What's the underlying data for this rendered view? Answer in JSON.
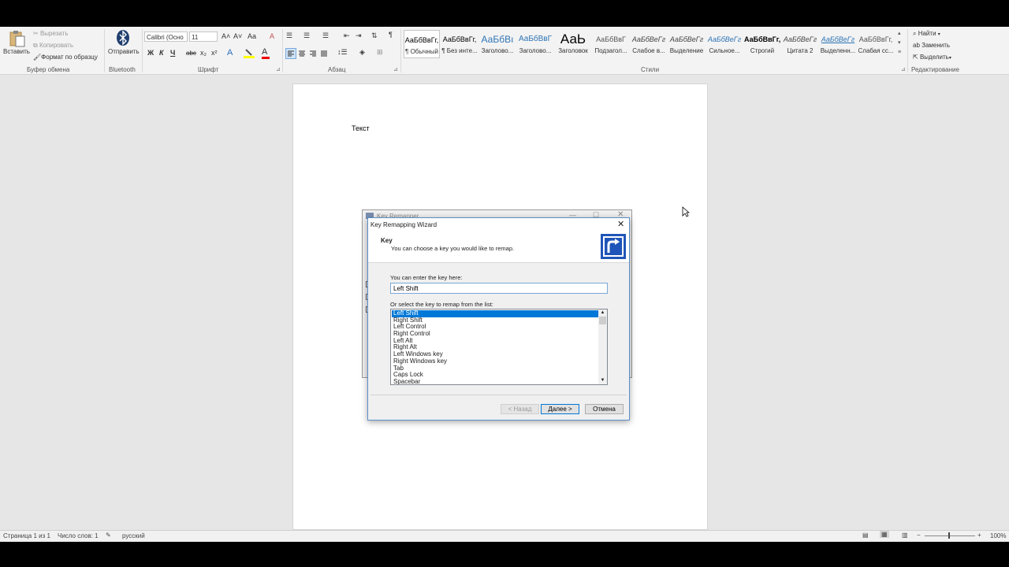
{
  "ribbon": {
    "clipboard": {
      "paste": "Вставить",
      "cut": "Вырезать",
      "copy": "Копировать",
      "format_painter": "Формат по образцу",
      "group": "Буфер обмена"
    },
    "bluetooth": {
      "send": "Отправить",
      "group": "Bluetooth"
    },
    "font": {
      "name": "Calibri (Осно",
      "size": "11",
      "group": "Шрифт",
      "bold": "Ж",
      "italic": "К",
      "underline": "Ч",
      "strike": "abc",
      "sub": "x₂",
      "sup": "x²",
      "grow": "A˄",
      "shrink": "A˅",
      "case": "Aa",
      "clear": "A"
    },
    "paragraph": {
      "group": "Абзац",
      "marks": "¶"
    },
    "styles": {
      "group": "Стили",
      "items": [
        {
          "preview": "АаБбВвГг,",
          "name": "¶ Обычный"
        },
        {
          "preview": "АаБбВвГг,",
          "name": "¶ Без инте..."
        },
        {
          "preview": "АаБбВı",
          "name": "Заголово..."
        },
        {
          "preview": "АаБбВвГ",
          "name": "Заголово..."
        },
        {
          "preview": "АаЬ",
          "name": "Заголовок"
        },
        {
          "preview": "АаБбВвГ",
          "name": "Подзагол..."
        },
        {
          "preview": "АаБбВеГг",
          "name": "Слабое в..."
        },
        {
          "preview": "АаБбВеГг",
          "name": "Выделение"
        },
        {
          "preview": "АаБбВеГг",
          "name": "Сильное..."
        },
        {
          "preview": "АаБбВвГг,",
          "name": "Строгий"
        },
        {
          "preview": "АаБбВеГг",
          "name": "Цитата 2"
        },
        {
          "preview": "АаБбВеГг",
          "name": "Выделенн..."
        },
        {
          "preview": "АаБбВвГг,",
          "name": "Слабая сс..."
        }
      ]
    },
    "editing": {
      "find": "Найти",
      "replace": "Заменить",
      "select": "Выделить",
      "group": "Редактирование"
    }
  },
  "document": {
    "text": "Текст"
  },
  "status": {
    "page": "Страница 1 из 1",
    "words": "Число слов: 1",
    "lang": "русский",
    "zoom": "100%"
  },
  "bg_window": {
    "title": "Key Remapper"
  },
  "wizard": {
    "title": "Key Remapping Wizard",
    "heading": "Key",
    "subheading": "You can choose a key you would like to remap.",
    "enter_label": "You can enter the key here:",
    "key_value": "Left Shift",
    "list_label": "Or select the key to remap from the list:",
    "keys": [
      "Left Shift",
      "Right Shift",
      "Left Control",
      "Right Control",
      "Left Alt",
      "Right Alt",
      "Left Windows key",
      "Right Windows key",
      "Tab",
      "Caps Lock",
      "Spacebar"
    ],
    "selected_index": 0,
    "back": "< Назад",
    "next": "Далее >",
    "cancel": "Отмена"
  },
  "colors": {
    "accent": "#0078d7",
    "dialog_border": "#5b8ec7"
  }
}
